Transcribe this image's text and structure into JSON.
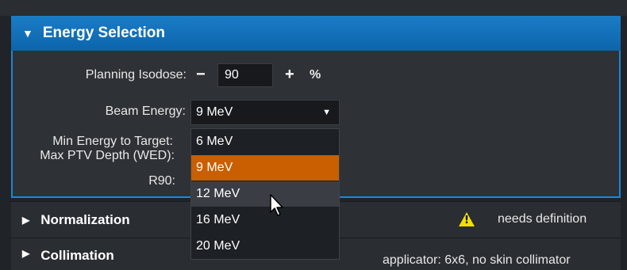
{
  "energy_selection": {
    "title": "Energy Selection",
    "planning_isodose_label": "Planning Isodose:",
    "minus_label": "−",
    "isodose_value": "90",
    "plus_label": "+",
    "percent_label": "%",
    "beam_energy_label": "Beam Energy:",
    "beam_energy_selected": "9 MeV",
    "min_energy_label": "Min Energy to Target:",
    "max_ptv_label": "Max PTV Depth (WED):",
    "r90_label": "R90:"
  },
  "dropdown": {
    "options": [
      "6 MeV",
      "9 MeV",
      "12 MeV",
      "16 MeV",
      "20 MeV"
    ],
    "selected_index": 1,
    "hover_index": 2
  },
  "normalization": {
    "title": "Normalization",
    "status": "needs definition",
    "status_icon": "warning-icon"
  },
  "collimation": {
    "title": "Collimation",
    "status": "applicator: 6x6, no skin collimator"
  },
  "colors": {
    "header_blue": "#1a7cc6",
    "selected_orange": "#c95f00",
    "warning_yellow": "#f0e000"
  }
}
